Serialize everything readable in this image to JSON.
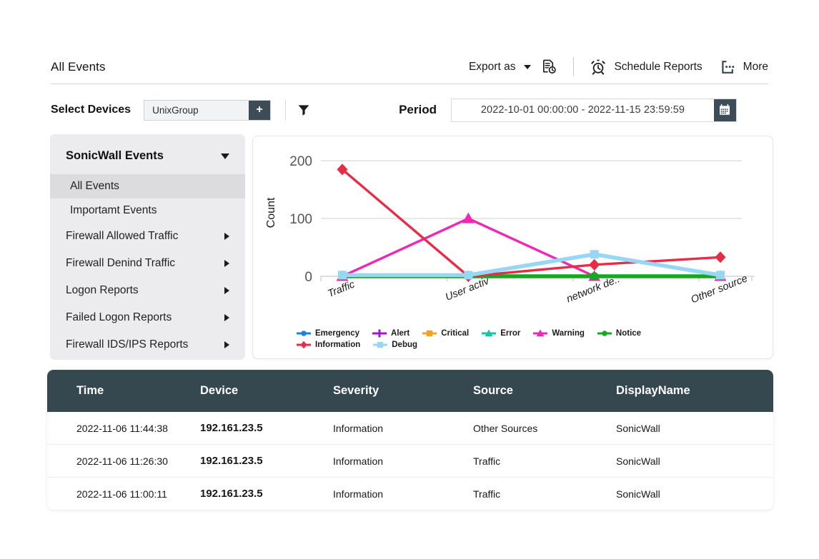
{
  "header": {
    "title": "All Events",
    "export_label": "Export as",
    "export_icon": "document-clock-icon",
    "schedule_label": "Schedule Reports",
    "schedule_icon": "alarm-clock-icon",
    "more_label": "More",
    "more_icon": "more-options-icon"
  },
  "filterbar": {
    "select_devices_label": "Select Devices",
    "device_value": "UnixGroup",
    "device_add_label": "+",
    "filter_icon": "funnel-icon",
    "period_label": "Period",
    "period_value": "2022-10-01 00:00:00 - 2022-11-15 23:59:59",
    "calendar_icon": "calendar-icon"
  },
  "sidebar": {
    "title": "SonicWall Events",
    "collapse_icon": "chevron-down-icon",
    "items": [
      {
        "label": "All Events",
        "type": "sub",
        "active": true
      },
      {
        "label": "Importamt Events",
        "type": "sub",
        "active": false
      },
      {
        "label": "Firewall Allowed Traffic",
        "type": "main",
        "expandable": true
      },
      {
        "label": "Firewall Denind Traffic",
        "type": "main",
        "expandable": true
      },
      {
        "label": "Logon Reports",
        "type": "main",
        "expandable": true
      },
      {
        "label": "Failed Logon Reports",
        "type": "main",
        "expandable": true
      },
      {
        "label": "Firewall IDS/IPS Reports",
        "type": "main",
        "expandable": true
      }
    ]
  },
  "chart_data": {
    "type": "line",
    "title": "",
    "xlabel": "",
    "ylabel": "Count",
    "categories": [
      "Traffic",
      "User activ",
      "network de..",
      "Other source"
    ],
    "ylim": [
      0,
      220
    ],
    "yticks": [
      0,
      100,
      200
    ],
    "grid": true,
    "legend_position": "bottom",
    "series": [
      {
        "name": "Emergency",
        "color": "#1c86d4",
        "marker": "circle",
        "values": [
          0,
          0,
          0,
          0
        ]
      },
      {
        "name": "Alert",
        "color": "#a515cf",
        "marker": "plus",
        "values": [
          0,
          0,
          0,
          0
        ]
      },
      {
        "name": "Critical",
        "color": "#f4a31c",
        "marker": "square",
        "values": [
          0,
          0,
          0,
          0
        ]
      },
      {
        "name": "Error",
        "color": "#12c7a6",
        "marker": "triangle",
        "values": [
          0,
          0,
          0,
          0
        ]
      },
      {
        "name": "Warning",
        "color": "#ef28b4",
        "marker": "triangle",
        "values": [
          0,
          100,
          0,
          0
        ]
      },
      {
        "name": "Notice",
        "color": "#16a81e",
        "marker": "circle",
        "values": [
          0,
          0,
          0,
          0
        ]
      },
      {
        "name": "Information",
        "color": "#e82b47",
        "marker": "diamond",
        "values": [
          185,
          0,
          20,
          33
        ]
      },
      {
        "name": "Debug",
        "color": "#97d7f5",
        "marker": "square",
        "values": [
          2,
          2,
          38,
          2
        ]
      }
    ]
  },
  "table": {
    "columns": [
      "Time",
      "Device",
      "Severity",
      "Source",
      "DisplayName"
    ],
    "rows": [
      {
        "time": "2022-11-06 11:44:38",
        "device": "192.161.23.5",
        "severity": "Information",
        "source": "Other Sources",
        "display_name": "SonicWall"
      },
      {
        "time": "2022-11-06 11:26:30",
        "device": "192.161.23.5",
        "severity": "Information",
        "source": "Traffic",
        "display_name": "SonicWall"
      },
      {
        "time": "2022-11-06 11:00:11",
        "device": "192.161.23.5",
        "severity": "Information",
        "source": "Traffic",
        "display_name": "SonicWall"
      }
    ]
  }
}
